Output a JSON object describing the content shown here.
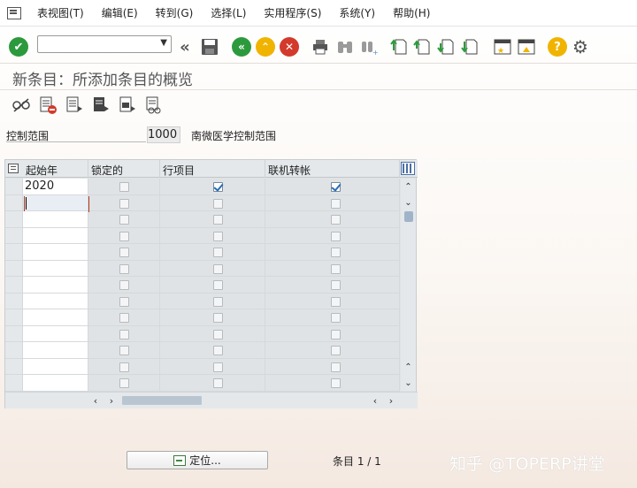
{
  "menu": {
    "items": [
      {
        "label": "表视图(T)"
      },
      {
        "label": "编辑(E)"
      },
      {
        "label": "转到(G)"
      },
      {
        "label": "选择(L)"
      },
      {
        "label": "实用程序(S)"
      },
      {
        "label": "系统(Y)"
      },
      {
        "label": "帮助(H)"
      }
    ]
  },
  "toolbar": {
    "command_value": "",
    "colors": {
      "enter": "#2c9a3c",
      "back": "#2c9a3c",
      "exit": "#f0b400",
      "cancel": "#d33a2c",
      "help": "#f0b400"
    }
  },
  "title": "新条目：所添加条目的概览",
  "field": {
    "label": "控制范围",
    "value": "1000",
    "description": "南微医学控制范围"
  },
  "table": {
    "columns": [
      "起始年",
      "锁定的",
      "行项目",
      "联机转帐"
    ],
    "rows": [
      {
        "year": "2020",
        "locked": false,
        "line_item": true,
        "online_post": true
      },
      {
        "year": "",
        "locked": false,
        "line_item": false,
        "online_post": false
      },
      {
        "year": "",
        "locked": false,
        "line_item": false,
        "online_post": false
      },
      {
        "year": "",
        "locked": false,
        "line_item": false,
        "online_post": false
      },
      {
        "year": "",
        "locked": false,
        "line_item": false,
        "online_post": false
      },
      {
        "year": "",
        "locked": false,
        "line_item": false,
        "online_post": false
      },
      {
        "year": "",
        "locked": false,
        "line_item": false,
        "online_post": false
      },
      {
        "year": "",
        "locked": false,
        "line_item": false,
        "online_post": false
      },
      {
        "year": "",
        "locked": false,
        "line_item": false,
        "online_post": false
      },
      {
        "year": "",
        "locked": false,
        "line_item": false,
        "online_post": false
      },
      {
        "year": "",
        "locked": false,
        "line_item": false,
        "online_post": false
      },
      {
        "year": "",
        "locked": false,
        "line_item": false,
        "online_post": false
      },
      {
        "year": "",
        "locked": false,
        "line_item": false,
        "online_post": false
      }
    ]
  },
  "footer": {
    "position_button": "定位...",
    "entry_info": "条目 1 / 1",
    "watermark": "知乎 @TOPERP讲堂"
  }
}
